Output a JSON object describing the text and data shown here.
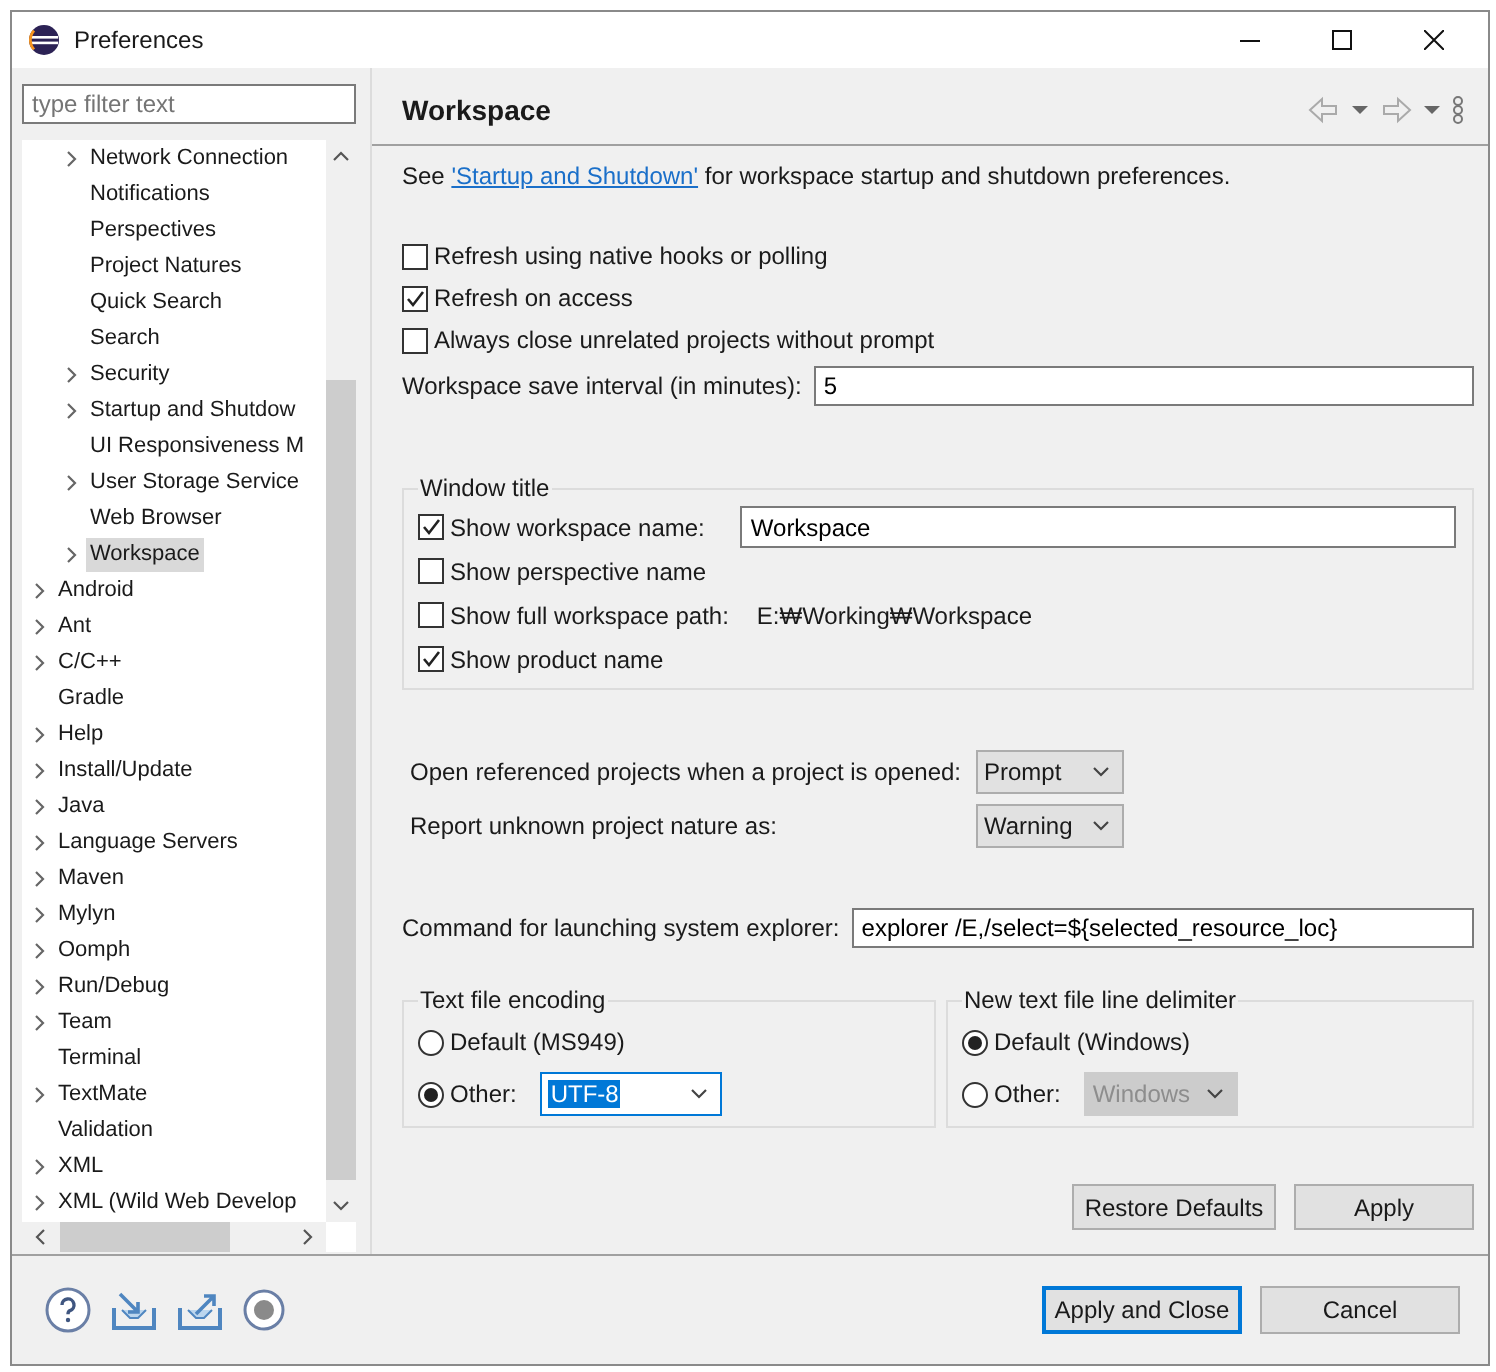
{
  "window": {
    "title": "Preferences"
  },
  "filter": {
    "placeholder": "type filter text"
  },
  "tree": [
    {
      "children": [
        {
          "label": "Network Connection",
          "expandable": true,
          "selected": false
        },
        {
          "label": "Notifications",
          "expandable": false,
          "selected": false
        },
        {
          "label": "Perspectives",
          "expandable": false,
          "selected": false
        },
        {
          "label": "Project Natures",
          "expandable": false,
          "selected": false
        },
        {
          "label": "Quick Search",
          "expandable": false,
          "selected": false
        },
        {
          "label": "Search",
          "expandable": false,
          "selected": false
        },
        {
          "label": "Security",
          "expandable": true,
          "selected": false
        },
        {
          "label": "Startup and Shutdow",
          "expandable": true,
          "selected": false
        },
        {
          "label": "UI Responsiveness M",
          "expandable": false,
          "selected": false
        },
        {
          "label": "User Storage Service",
          "expandable": true,
          "selected": false
        },
        {
          "label": "Web Browser",
          "expandable": false,
          "selected": false
        },
        {
          "label": "Workspace",
          "expandable": true,
          "selected": true
        }
      ]
    },
    {
      "label": "Android",
      "expandable": true,
      "selected": false
    },
    {
      "label": "Ant",
      "expandable": true,
      "selected": false
    },
    {
      "label": "C/C++",
      "expandable": true,
      "selected": false
    },
    {
      "label": "Gradle",
      "expandable": false,
      "selected": false
    },
    {
      "label": "Help",
      "expandable": true,
      "selected": false
    },
    {
      "label": "Install/Update",
      "expandable": true,
      "selected": false
    },
    {
      "label": "Java",
      "expandable": true,
      "selected": false
    },
    {
      "label": "Language Servers",
      "expandable": true,
      "selected": false
    },
    {
      "label": "Maven",
      "expandable": true,
      "selected": false
    },
    {
      "label": "Mylyn",
      "expandable": true,
      "selected": false
    },
    {
      "label": "Oomph",
      "expandable": true,
      "selected": false
    },
    {
      "label": "Run/Debug",
      "expandable": true,
      "selected": false
    },
    {
      "label": "Team",
      "expandable": true,
      "selected": false
    },
    {
      "label": "Terminal",
      "expandable": false,
      "selected": false
    },
    {
      "label": "TextMate",
      "expandable": true,
      "selected": false
    },
    {
      "label": "Validation",
      "expandable": false,
      "selected": false
    },
    {
      "label": "XML",
      "expandable": true,
      "selected": false
    },
    {
      "label": "XML (Wild Web Develop",
      "expandable": true,
      "selected": false
    }
  ],
  "page": {
    "title": "Workspace",
    "intro_before": "See ",
    "intro_link": "'Startup and Shutdown'",
    "intro_after": " for workspace startup and shutdown preferences."
  },
  "options": [
    {
      "label": "Refresh using native hooks or polling",
      "checked": false
    },
    {
      "label": "Refresh on access",
      "checked": true
    },
    {
      "label": "Always close unrelated projects without prompt",
      "checked": false
    }
  ],
  "save_interval": {
    "label": "Workspace save interval (in minutes):",
    "value": "5"
  },
  "window_title_group": {
    "title": "Window title",
    "rows": [
      {
        "kind": "field",
        "label": "Show workspace name:",
        "checked": true,
        "value": "Workspace"
      },
      {
        "kind": "plain",
        "label": "Show perspective name",
        "checked": false
      },
      {
        "kind": "text",
        "label": "Show full workspace path:",
        "checked": false,
        "text": "E:₩Working₩Workspace"
      },
      {
        "kind": "plain",
        "label": "Show product name",
        "checked": true
      }
    ]
  },
  "dropdowns": [
    {
      "label": "Open referenced projects when a project is opened:",
      "value": "Prompt"
    },
    {
      "label": "Report unknown project nature as:",
      "value": "Warning"
    }
  ],
  "explorer_command": {
    "label": "Command for launching system explorer:",
    "value": "explorer /E,/select=${selected_resource_loc}"
  },
  "radio_groups": [
    {
      "title": "Text file encoding",
      "options": [
        {
          "kind": "plain",
          "label": "Default (MS949)",
          "selected": false
        },
        {
          "kind": "combo",
          "label": "Other:",
          "selected": true,
          "value": "UTF-8",
          "disabled": false,
          "focused": true
        }
      ]
    },
    {
      "title": "New text file line delimiter",
      "options": [
        {
          "kind": "plain",
          "label": "Default (Windows)",
          "selected": true
        },
        {
          "kind": "combo",
          "label": "Other:",
          "selected": false,
          "value": "Windows",
          "disabled": true,
          "focused": false
        }
      ]
    }
  ],
  "page_buttons": [
    "Restore Defaults",
    "Apply"
  ],
  "dialog_buttons": [
    {
      "label": "Apply and Close",
      "default": true
    },
    {
      "label": "Cancel",
      "default": false
    }
  ]
}
